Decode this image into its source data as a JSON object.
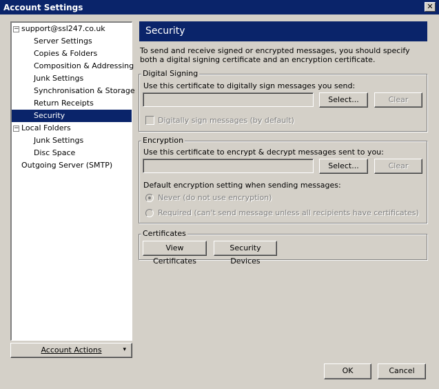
{
  "window": {
    "title": "Account Settings",
    "close_symbol": "✕"
  },
  "tree": {
    "items": [
      {
        "label": "support@ssl247.co.uk",
        "expander": "−"
      },
      {
        "label": "Server Settings"
      },
      {
        "label": "Copies & Folders"
      },
      {
        "label": "Composition & Addressing"
      },
      {
        "label": "Junk Settings"
      },
      {
        "label": "Synchronisation & Storage"
      },
      {
        "label": "Return Receipts"
      },
      {
        "label": "Security"
      },
      {
        "label": "Local Folders",
        "expander": "−"
      },
      {
        "label": "Junk Settings"
      },
      {
        "label": "Disc Space"
      },
      {
        "label": "Outgoing Server (SMTP)"
      }
    ],
    "selected_index": 7
  },
  "account_actions": {
    "label": "Account Actions",
    "arrow": "▾"
  },
  "panel": {
    "title": "Security",
    "description": "To send and receive signed or encrypted messages, you should specify both a digital signing certificate and an encryption certificate."
  },
  "digital_signing": {
    "legend": "Digital Signing",
    "instruction": "Use this certificate to digitally sign messages you send:",
    "field_value": "",
    "select_label": "Select...",
    "clear_label": "Clear",
    "checkbox_label": "Digitally sign messages (by default)"
  },
  "encryption": {
    "legend": "Encryption",
    "instruction": "Use this certificate to encrypt & decrypt messages sent to you:",
    "field_value": "",
    "select_label": "Select...",
    "clear_label": "Clear",
    "default_setting_label": "Default encryption setting when sending messages:",
    "radio_never": "Never (do not use encryption)",
    "radio_required": "Required (can't send message unless all recipients have certificates)"
  },
  "certificates": {
    "legend": "Certificates",
    "view_label": "View Certificates",
    "devices_label": "Security Devices"
  },
  "footer": {
    "ok_label": "OK",
    "cancel_label": "Cancel"
  }
}
